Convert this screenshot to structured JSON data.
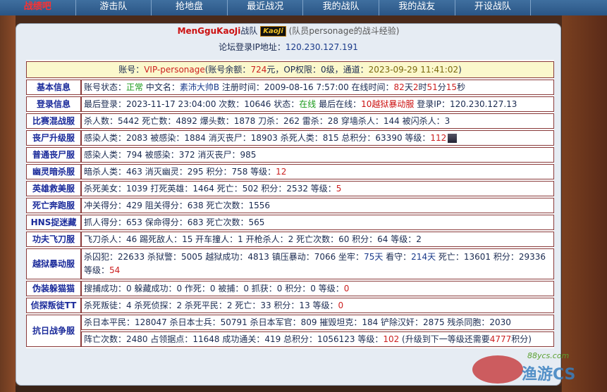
{
  "nav": [
    {
      "label": "战绩吧",
      "active": true
    },
    {
      "label": "游击队"
    },
    {
      "label": "抢地盘"
    },
    {
      "label": "最近战况"
    },
    {
      "label": "我的战队"
    },
    {
      "label": "我的战友"
    },
    {
      "label": "开设战队"
    }
  ],
  "header": {
    "team": "MenGguKaoJi",
    "team_suffix": "战队",
    "badge": "KaoJi",
    "sub": "(队员personage的战斗经验)"
  },
  "ip": {
    "label": "论坛登录IP地址：",
    "value": "120.230.127.191"
  },
  "account": {
    "l1": "账号：",
    "vip": "VIP-personage",
    "l2": "(账号余额：",
    "balance": "724",
    "l3": "元，OP权限：0级，通道：",
    "date": "2023-09-29 11:41:02",
    "l4": ")"
  },
  "rows": [
    {
      "head": "基本信息",
      "parts": [
        [
          "账号状态：",
          ""
        ],
        [
          "正常",
          "g"
        ],
        [
          " 中文名：",
          ""
        ],
        [
          "素沛大帅B",
          "b"
        ],
        [
          " 注册时间：2009-08-16 7:57:00 在线时间：",
          ""
        ],
        [
          "82",
          "r"
        ],
        [
          "天",
          ""
        ],
        [
          "2",
          "r"
        ],
        [
          "时",
          ""
        ],
        [
          "51",
          "r"
        ],
        [
          "分",
          ""
        ],
        [
          "15",
          "r"
        ],
        [
          "秒",
          ""
        ]
      ]
    },
    {
      "head": "登录信息",
      "parts": [
        [
          "最后登录：2023-11-17 23:04:00 次数：10646 状态：",
          ""
        ],
        [
          "在线",
          "g"
        ],
        [
          " 最后在线：",
          ""
        ],
        [
          "10越狱暴动服",
          "o"
        ],
        [
          " 登录IP：120.230.127.13",
          ""
        ]
      ]
    },
    {
      "head": "比赛混战服",
      "parts": [
        [
          "杀人数：5442 死亡数：4892 爆头数：1878 刀杀：262 雷杀：28 穿墙杀人：144 被闪杀人：3",
          ""
        ]
      ]
    },
    {
      "head": "丧尸升级服",
      "parts": [
        [
          "感染人类：2083 被感染：1884 消灭丧尸：18903 杀死人类：815 总积分：63390 等级：",
          ""
        ],
        [
          "112",
          "r"
        ]
      ],
      "avatar": true
    },
    {
      "head": "普通丧尸服",
      "parts": [
        [
          "感染人类：794 被感染：372 消灭丧尸：985",
          ""
        ]
      ]
    },
    {
      "head": "幽灵暗杀服",
      "parts": [
        [
          "暗杀人类：463 消灭幽灵：295 积分：758 等级：",
          ""
        ],
        [
          "12",
          "r"
        ]
      ]
    },
    {
      "head": "英雄救美服",
      "parts": [
        [
          "杀死美女：1039 打死英雄：1464 死亡：502 积分：2532 等级：",
          ""
        ],
        [
          "5",
          "r"
        ]
      ]
    },
    {
      "head": "死亡奔跑服",
      "parts": [
        [
          "冲关得分：429 阻关得分：638 死亡次数：1556",
          ""
        ]
      ]
    },
    {
      "head": "HNS捉迷藏",
      "parts": [
        [
          "抓人得分：653 保命得分：683 死亡次数：565",
          ""
        ]
      ]
    },
    {
      "head": "功夫飞刀服",
      "parts": [
        [
          "飞刀杀人：46 踢死敌人：15 开车撞人：1 开枪杀人：2 死亡次数：60 积分：64 等级：2",
          ""
        ]
      ]
    },
    {
      "head": "越狱暴动服",
      "tall": true,
      "parts": [
        [
          "杀囚犯：22633 杀狱警：5005 越狱成功：4813 镇压暴动：7066 坐牢：",
          ""
        ],
        [
          "75天",
          "b"
        ],
        [
          " 看守：",
          ""
        ],
        [
          "214天",
          "b"
        ],
        [
          " 死亡：13601 积分：29336 等级：",
          ""
        ],
        [
          "54",
          "r"
        ]
      ]
    },
    {
      "head": "伪装躲猫猫",
      "parts": [
        [
          "搜捕成功：0 躲藏成功：0 作死：0 被捕：0 抓获：0 积分：0 等级：",
          ""
        ],
        [
          "0",
          "r"
        ]
      ]
    },
    {
      "head": "侦探叛徒TT",
      "parts": [
        [
          "杀死叛徒：4 杀死侦探：2 杀死平民：2 死亡：33 积分：13 等级：",
          ""
        ],
        [
          "0",
          "r"
        ]
      ]
    }
  ],
  "war": {
    "head": "抗日战争服",
    "line1": "杀日本平民：128047 杀日本士兵：50791 杀日本军官：809 摧毁坦克：184 铲除汉奸：2875 残杀同胞：2030",
    "line2a": "阵亡次数：2480 占领据点：11648 成功通关：419 总积分：1056123 等级：",
    "level": "102",
    "line2b": " (升级到下一等级还需要",
    "need": "4777",
    "line2c": "积分)"
  },
  "watermark": {
    "text": "渔游CS",
    "site": "88ycs.com"
  }
}
